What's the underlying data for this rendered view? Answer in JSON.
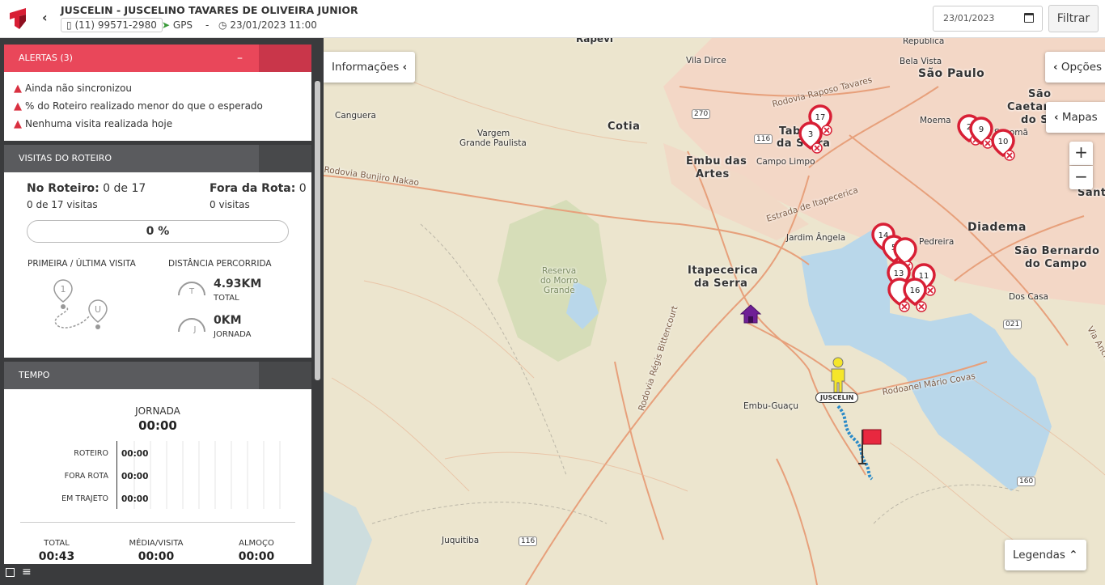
{
  "header": {
    "agent_name": "JUSCELIN - JUSCELINO TAVARES DE OLIVEIRA JUNIOR",
    "phone": "(11) 99571-2980",
    "signal": "GPS",
    "separator": "-",
    "datetime": "23/01/2023 11:00",
    "date_value": "23/01/2023",
    "filter_label": "Filtrar"
  },
  "alerts": {
    "title": "ALERTAS (3)",
    "items": [
      "Ainda não sincronizou",
      "% do Roteiro realizado menor do que o esperado",
      "Nenhuma visita realizada hoje"
    ]
  },
  "visits": {
    "title": "VISITAS DO ROTEIRO",
    "on_route_label": "No Roteiro:",
    "on_route_value": "0 de 17",
    "on_route_sub": "0 de 17 visitas",
    "off_route_label": "Fora da Rota:",
    "off_route_value": "0",
    "off_route_sub": "0 visitas",
    "progress_text": "0 %",
    "progress": 0,
    "first_last_label": "PRIMEIRA / ÚLTIMA VISITA",
    "first_marker": "1",
    "last_marker": "U",
    "distance_label": "DISTÂNCIA PERCORRIDA",
    "distance_total": "4.93KM",
    "distance_total_label": "TOTAL",
    "distance_total_marker": "T",
    "distance_journey": "0KM",
    "distance_journey_label": "JORNADA",
    "distance_journey_marker": "J"
  },
  "time": {
    "title": "TEMPO",
    "journey_label": "JORNADA",
    "journey_value": "00:00",
    "rows": [
      {
        "label": "ROTEIRO",
        "value": "00:00"
      },
      {
        "label": "FORA ROTA",
        "value": "00:00"
      },
      {
        "label": "EM TRAJETO",
        "value": "00:00"
      }
    ],
    "total_label": "TOTAL",
    "total_value": "00:43",
    "avg_label": "MÉDIA/VISITA",
    "avg_value": "00:00",
    "lunch_label": "ALMOÇO",
    "lunch_value": "00:00"
  },
  "map": {
    "info_button": "Informações",
    "options_button": "Opções",
    "maps_button": "Mapas",
    "zoom_in": "+",
    "zoom_out": "−",
    "legend_button": "Legendas",
    "agent_label": "JUSCELIN",
    "places": [
      "Rapevi",
      "República",
      "Vila Dirce",
      "Bela Vista",
      "São Paulo",
      "Rodovia Raposo Tavares",
      "Canguera",
      "Cotia",
      "Vargem",
      "Grande Paulista",
      "Taboão",
      "da Serra",
      "Moema",
      "São",
      "Caetano",
      "do Sul",
      "Sacomã",
      "Embu das",
      "Artes",
      "Campo Limpo",
      "Rodovia Bunjiro Nakao",
      "Estrada de Itapecerica",
      "Diadema",
      "Jardim Ângela",
      "Pedreira",
      "São Bernardo",
      "do Campo",
      "Santo",
      "Reserva",
      "do Morro",
      "Grande",
      "Itapecerica",
      "da Serra",
      "Dos Casa",
      "Rodovia Régis Bittencourt",
      "Rodoanel Mário Covas",
      "Embu-Guaçu",
      "Juquitiba",
      "Via Anchieta"
    ],
    "road_shields": [
      "270",
      "116",
      "021",
      "160",
      "116"
    ],
    "pins": [
      "17",
      "3",
      "2",
      "9",
      "10",
      "14",
      "5",
      "13",
      "11",
      "16"
    ]
  },
  "colors": {
    "alert_red": "#e9475a",
    "sidebar_dark": "#3a3b3d",
    "pin_red": "#d81f35",
    "home_purple": "#6f2096",
    "agent_yellow": "#f5e62a"
  }
}
